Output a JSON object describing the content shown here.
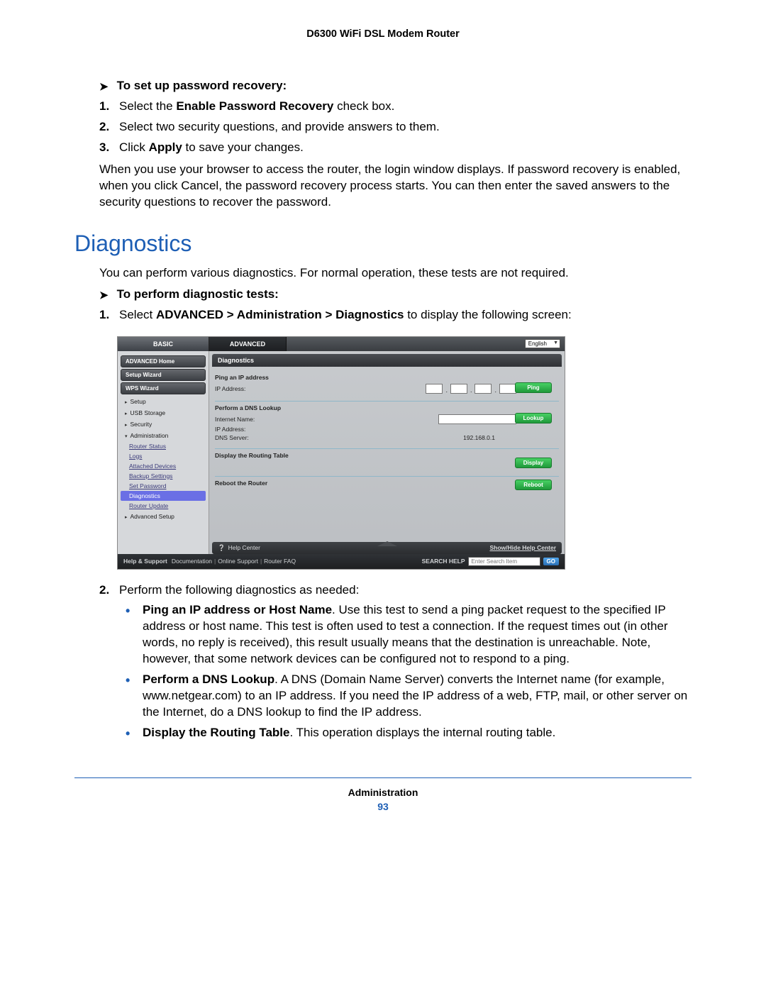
{
  "header": "D6300 WiFi DSL Modem Router",
  "pwd": {
    "heading": "To set up password recovery:",
    "s1a": "Select the ",
    "s1b": "Enable Password Recovery",
    "s1c": " check box.",
    "s2": "Select two security questions, and provide answers to them.",
    "s3a": "Click ",
    "s3b": "Apply",
    "s3c": " to save your changes.",
    "para": "When you use your browser to access the router, the login window displays. If password recovery is enabled, when you click Cancel, the password recovery process starts. You can then enter the saved answers to the security questions to recover the password."
  },
  "diag": {
    "title": "Diagnostics",
    "intro": "You can perform various diagnostics. For normal operation, these tests are not required.",
    "heading": "To perform diagnostic tests:",
    "s1a": "Select ",
    "s1b": "ADVANCED > Administration > Diagnostics",
    "s1c": " to display the following screen:",
    "s2": "Perform the following diagnostics as needed:",
    "b1t": "Ping an IP address or Host Name",
    "b1": ". Use this test to send a ping packet request to the specified IP address or host name. This test is often used to test a connection. If the request times out (in other words, no reply is received), this result usually means that the destination is unreachable. Note, however, that some network devices can be configured not to respond to a ping.",
    "b2t": "Perform a DNS Lookup",
    "b2": ". A DNS (Domain Name Server) converts the Internet name (for example, www.netgear.com) to an IP address. If you need the IP address of a web, FTP, mail, or other server on the Internet, do a DNS lookup to find the IP address.",
    "b3t": "Display the Routing Table",
    "b3": ". This operation displays the internal routing table."
  },
  "fig": {
    "tabs": {
      "basic": "BASIC",
      "advanced": "ADVANCED"
    },
    "lang": "English",
    "sidebar": {
      "pills": [
        "ADVANCED Home",
        "Setup Wizard",
        "WPS Wizard"
      ],
      "items": [
        "Setup",
        "USB Storage",
        "Security",
        "Administration",
        "Advanced Setup"
      ],
      "subs": [
        "Router Status",
        "Logs",
        "Attached Devices",
        "Backup Settings",
        "Set Password",
        "Diagnostics",
        "Router Update"
      ]
    },
    "main": {
      "title": "Diagnostics",
      "ping": {
        "title": "Ping an IP address",
        "label": "IP Address:",
        "btn": "Ping"
      },
      "dns": {
        "title": "Perform a DNS Lookup",
        "name": "Internet Name:",
        "ip": "IP Address:",
        "server": "DNS Server:",
        "serverVal": "192.168.0.1",
        "btn": "Lookup"
      },
      "route": {
        "title": "Display the Routing Table",
        "btn": "Display"
      },
      "reboot": {
        "title": "Reboot the Router",
        "btn": "Reboot"
      }
    },
    "help": {
      "label": "Help Center",
      "toggle": "Show/Hide Help Center"
    },
    "support": {
      "label": "Help & Support",
      "links": [
        "Documentation",
        "Online Support",
        "Router FAQ"
      ],
      "searchLabel": "SEARCH HELP",
      "placeholder": "Enter Search Item",
      "go": "GO"
    }
  },
  "footer": {
    "section": "Administration",
    "page": "93"
  }
}
